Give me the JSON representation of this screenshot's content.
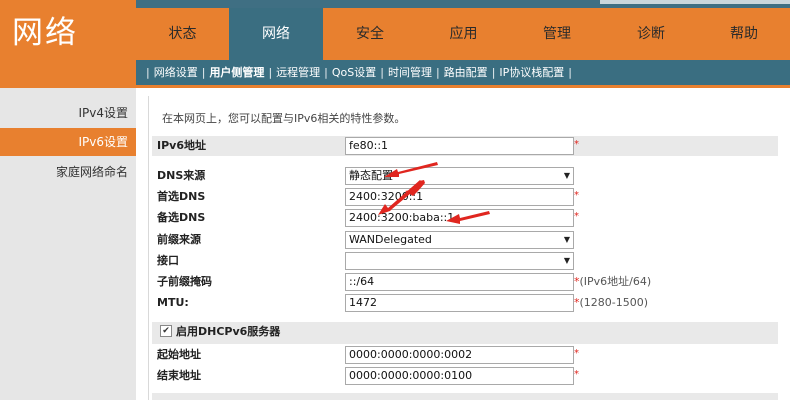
{
  "brand": "网络",
  "colors": {
    "primary": "#e8802f",
    "nav": "#3a6e81",
    "annotation": "#e0261f"
  },
  "tabs": [
    "状态",
    "网络",
    "安全",
    "应用",
    "管理",
    "诊断",
    "帮助"
  ],
  "active_tab": "网络",
  "subnav": [
    "网络设置",
    "用户侧管理",
    "远程管理",
    "QoS设置",
    "时间管理",
    "路由配置",
    "IP协议栈配置"
  ],
  "subnav_active": "用户侧管理",
  "sidebar": [
    "IPv4设置",
    "IPv6设置",
    "家庭网络命名"
  ],
  "sidebar_active": "IPv6设置",
  "intro": "在本网页上，您可以配置与IPv6相关的特性参数。",
  "form": {
    "ipv6_address": {
      "label": "IPv6地址",
      "value": "fe80::1",
      "required": "*"
    },
    "dns_source": {
      "label": "DNS来源",
      "value": "静态配置"
    },
    "primary_dns": {
      "label": "首选DNS",
      "value": "2400:3200::1",
      "required": "*"
    },
    "secondary_dns": {
      "label": "备选DNS",
      "value": "2400:3200:baba::1",
      "required": "*"
    },
    "prefix_source": {
      "label": "前缀来源",
      "value": "WANDelegated"
    },
    "interface": {
      "label": "接口",
      "value": ""
    },
    "prefix_mask": {
      "label": "子前缀掩码",
      "value": "::/64",
      "hint_star": "*",
      "hint": "(IPv6地址/64)"
    },
    "mtu": {
      "label": "MTU:",
      "value": "1472",
      "hint_star": "*",
      "hint": "(1280-1500)"
    },
    "dhcpv6_enable": {
      "label": "启用DHCPv6服务器",
      "checked": true
    },
    "start_address": {
      "label": "起始地址",
      "value": "0000:0000:0000:0002",
      "required": "*"
    },
    "end_address": {
      "label": "结束地址",
      "value": "0000:0000:0000:0100",
      "required": "*"
    }
  }
}
